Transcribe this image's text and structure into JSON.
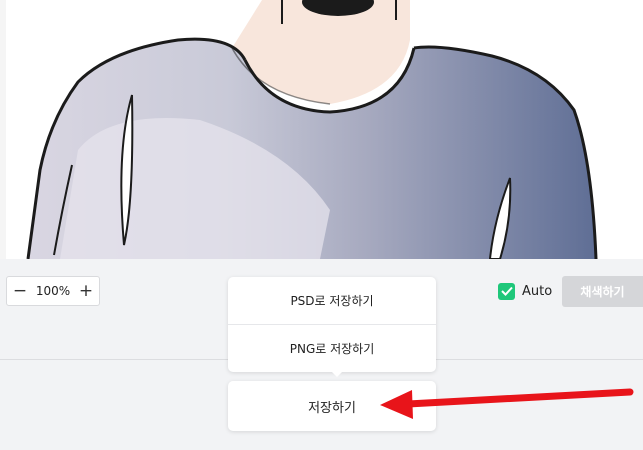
{
  "canvas": {
    "image_name": "line-art-person-in-shirt"
  },
  "zoom": {
    "minus": "−",
    "value": "100%",
    "plus": "+"
  },
  "save_menu": {
    "items": [
      {
        "label": "PSD로 저장하기"
      },
      {
        "label": "PNG로 저장하기"
      }
    ]
  },
  "save_button": {
    "label": "저장하기"
  },
  "auto_toggle": {
    "label": "Auto",
    "checked": true,
    "accent": "#1fc77a"
  },
  "colorize_button": {
    "label": "채색하기"
  },
  "annotation": {
    "arrow_color": "#e8141a"
  }
}
